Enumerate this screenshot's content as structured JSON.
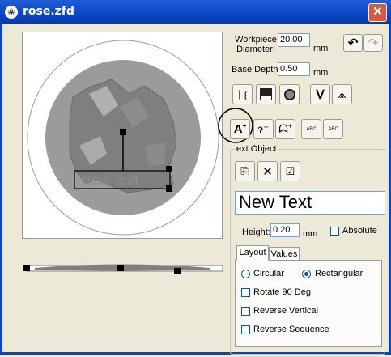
{
  "window": {
    "title": "rose.zfd",
    "close_glyph": "✕"
  },
  "params": {
    "workpiece_label_line1": "Workpiece",
    "workpiece_label_line2": "Diameter:",
    "workpiece_value": "20.00",
    "workpiece_unit": "mm",
    "base_depth_label": "Base Depth:",
    "base_depth_value": "0.50",
    "base_depth_unit": "mm"
  },
  "text_object": {
    "group_label": "ext Object",
    "text_value": "New Text",
    "height_label": "Height:",
    "height_value": "0.20",
    "height_unit": "mm",
    "absolute_label": "Absolute"
  },
  "tabs": [
    {
      "label": "Layout"
    },
    {
      "label": "Values"
    }
  ],
  "layout": {
    "circular_label": "Circular",
    "rectangular_label": "Rectangular",
    "rotate_label": "Rotate 90 Deg",
    "reverse_vertical_label": "Reverse Vertical",
    "reverse_sequence_label": "Reverse Sequence",
    "selected_mode": "Rectangular"
  },
  "toolbar_icons": {
    "small_text_a": "ABC",
    "small_text_b": "ABC"
  }
}
